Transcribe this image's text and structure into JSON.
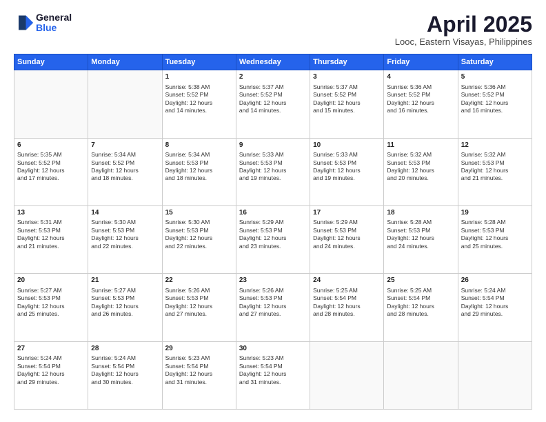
{
  "logo": {
    "general": "General",
    "blue": "Blue"
  },
  "header": {
    "month": "April 2025",
    "location": "Looc, Eastern Visayas, Philippines"
  },
  "weekdays": [
    "Sunday",
    "Monday",
    "Tuesday",
    "Wednesday",
    "Thursday",
    "Friday",
    "Saturday"
  ],
  "weeks": [
    [
      {
        "day": "",
        "content": ""
      },
      {
        "day": "",
        "content": ""
      },
      {
        "day": "1",
        "content": "Sunrise: 5:38 AM\nSunset: 5:52 PM\nDaylight: 12 hours\nand 14 minutes."
      },
      {
        "day": "2",
        "content": "Sunrise: 5:37 AM\nSunset: 5:52 PM\nDaylight: 12 hours\nand 14 minutes."
      },
      {
        "day": "3",
        "content": "Sunrise: 5:37 AM\nSunset: 5:52 PM\nDaylight: 12 hours\nand 15 minutes."
      },
      {
        "day": "4",
        "content": "Sunrise: 5:36 AM\nSunset: 5:52 PM\nDaylight: 12 hours\nand 16 minutes."
      },
      {
        "day": "5",
        "content": "Sunrise: 5:36 AM\nSunset: 5:52 PM\nDaylight: 12 hours\nand 16 minutes."
      }
    ],
    [
      {
        "day": "6",
        "content": "Sunrise: 5:35 AM\nSunset: 5:52 PM\nDaylight: 12 hours\nand 17 minutes."
      },
      {
        "day": "7",
        "content": "Sunrise: 5:34 AM\nSunset: 5:52 PM\nDaylight: 12 hours\nand 18 minutes."
      },
      {
        "day": "8",
        "content": "Sunrise: 5:34 AM\nSunset: 5:53 PM\nDaylight: 12 hours\nand 18 minutes."
      },
      {
        "day": "9",
        "content": "Sunrise: 5:33 AM\nSunset: 5:53 PM\nDaylight: 12 hours\nand 19 minutes."
      },
      {
        "day": "10",
        "content": "Sunrise: 5:33 AM\nSunset: 5:53 PM\nDaylight: 12 hours\nand 19 minutes."
      },
      {
        "day": "11",
        "content": "Sunrise: 5:32 AM\nSunset: 5:53 PM\nDaylight: 12 hours\nand 20 minutes."
      },
      {
        "day": "12",
        "content": "Sunrise: 5:32 AM\nSunset: 5:53 PM\nDaylight: 12 hours\nand 21 minutes."
      }
    ],
    [
      {
        "day": "13",
        "content": "Sunrise: 5:31 AM\nSunset: 5:53 PM\nDaylight: 12 hours\nand 21 minutes."
      },
      {
        "day": "14",
        "content": "Sunrise: 5:30 AM\nSunset: 5:53 PM\nDaylight: 12 hours\nand 22 minutes."
      },
      {
        "day": "15",
        "content": "Sunrise: 5:30 AM\nSunset: 5:53 PM\nDaylight: 12 hours\nand 22 minutes."
      },
      {
        "day": "16",
        "content": "Sunrise: 5:29 AM\nSunset: 5:53 PM\nDaylight: 12 hours\nand 23 minutes."
      },
      {
        "day": "17",
        "content": "Sunrise: 5:29 AM\nSunset: 5:53 PM\nDaylight: 12 hours\nand 24 minutes."
      },
      {
        "day": "18",
        "content": "Sunrise: 5:28 AM\nSunset: 5:53 PM\nDaylight: 12 hours\nand 24 minutes."
      },
      {
        "day": "19",
        "content": "Sunrise: 5:28 AM\nSunset: 5:53 PM\nDaylight: 12 hours\nand 25 minutes."
      }
    ],
    [
      {
        "day": "20",
        "content": "Sunrise: 5:27 AM\nSunset: 5:53 PM\nDaylight: 12 hours\nand 25 minutes."
      },
      {
        "day": "21",
        "content": "Sunrise: 5:27 AM\nSunset: 5:53 PM\nDaylight: 12 hours\nand 26 minutes."
      },
      {
        "day": "22",
        "content": "Sunrise: 5:26 AM\nSunset: 5:53 PM\nDaylight: 12 hours\nand 27 minutes."
      },
      {
        "day": "23",
        "content": "Sunrise: 5:26 AM\nSunset: 5:53 PM\nDaylight: 12 hours\nand 27 minutes."
      },
      {
        "day": "24",
        "content": "Sunrise: 5:25 AM\nSunset: 5:54 PM\nDaylight: 12 hours\nand 28 minutes."
      },
      {
        "day": "25",
        "content": "Sunrise: 5:25 AM\nSunset: 5:54 PM\nDaylight: 12 hours\nand 28 minutes."
      },
      {
        "day": "26",
        "content": "Sunrise: 5:24 AM\nSunset: 5:54 PM\nDaylight: 12 hours\nand 29 minutes."
      }
    ],
    [
      {
        "day": "27",
        "content": "Sunrise: 5:24 AM\nSunset: 5:54 PM\nDaylight: 12 hours\nand 29 minutes."
      },
      {
        "day": "28",
        "content": "Sunrise: 5:24 AM\nSunset: 5:54 PM\nDaylight: 12 hours\nand 30 minutes."
      },
      {
        "day": "29",
        "content": "Sunrise: 5:23 AM\nSunset: 5:54 PM\nDaylight: 12 hours\nand 31 minutes."
      },
      {
        "day": "30",
        "content": "Sunrise: 5:23 AM\nSunset: 5:54 PM\nDaylight: 12 hours\nand 31 minutes."
      },
      {
        "day": "",
        "content": ""
      },
      {
        "day": "",
        "content": ""
      },
      {
        "day": "",
        "content": ""
      }
    ]
  ]
}
